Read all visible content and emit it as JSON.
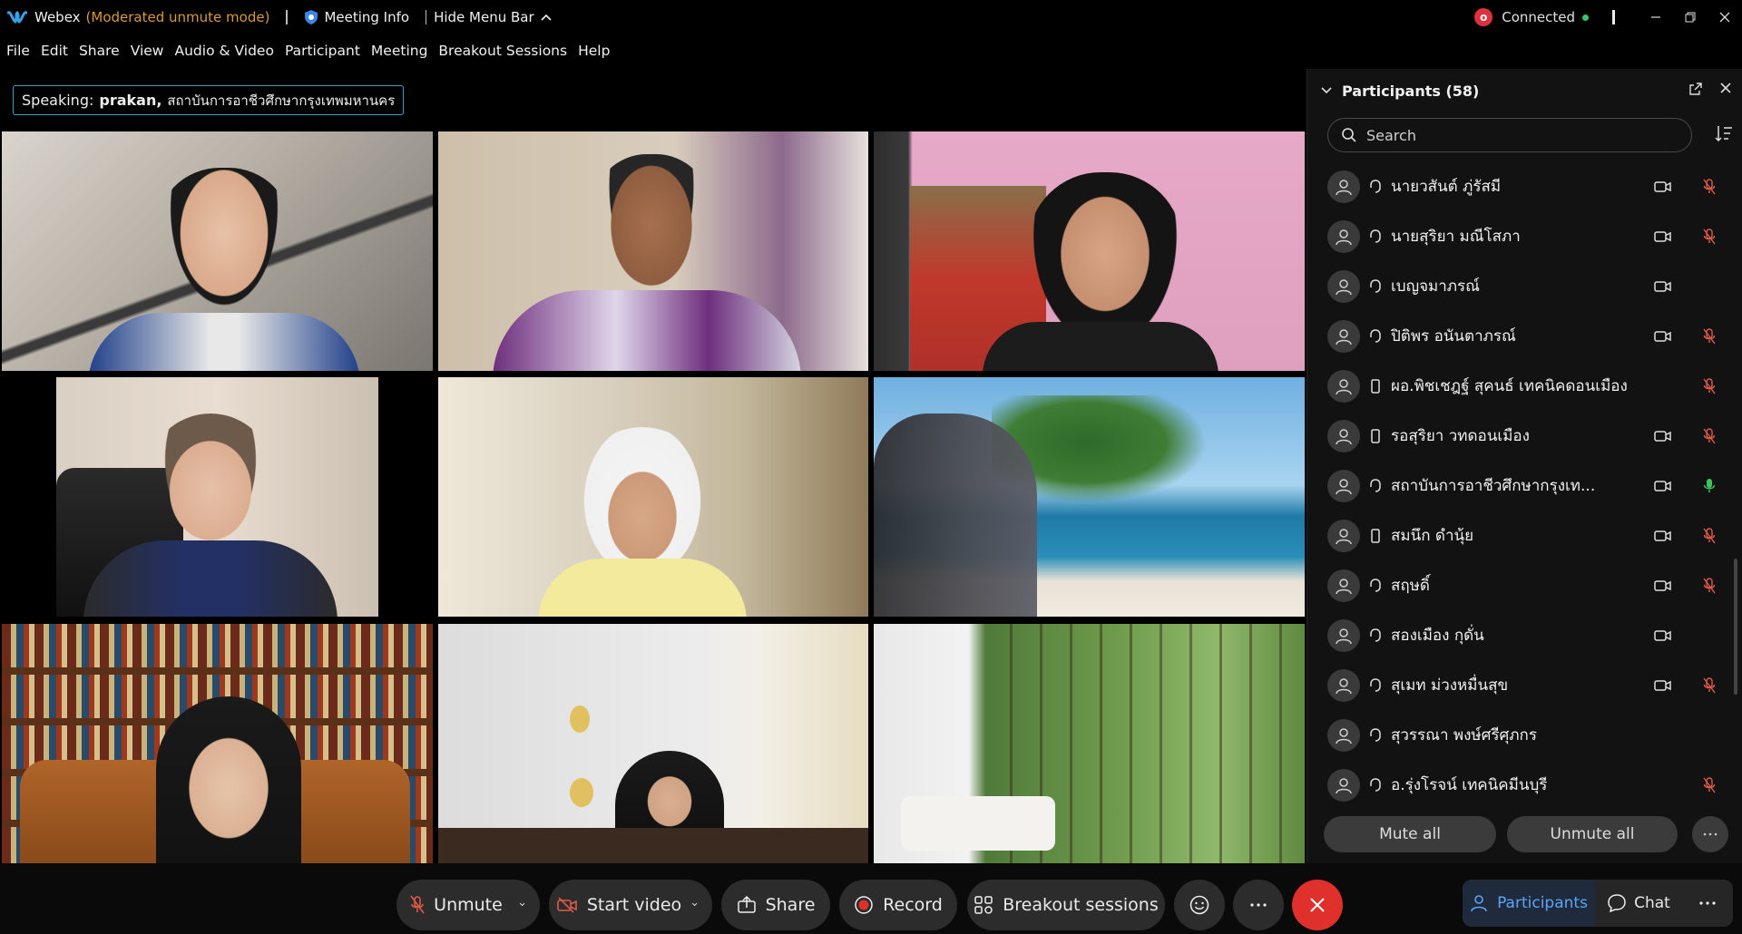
{
  "titlebar": {
    "app_name": "Webex",
    "mode": "(Moderated unmute mode)",
    "meeting_info": "Meeting Info",
    "hide_menu": "Hide Menu Bar",
    "rec_badge": "o",
    "connected": "Connected"
  },
  "menu": [
    "File",
    "Edit",
    "Share",
    "View",
    "Audio & Video",
    "Participant",
    "Meeting",
    "Breakout Sessions",
    "Help"
  ],
  "speaking": {
    "label": "Speaking:",
    "name": "prakan,",
    "org": "สถาบันการอาชีวศึกษากรุงเทพมหานคร"
  },
  "panel": {
    "title": "Participants (58)",
    "search_placeholder": "Search",
    "participants": [
      {
        "name": "นายวสันต์ ภู่รัสมี",
        "device": "headset",
        "camera": true,
        "mic": "muted"
      },
      {
        "name": "นายสุริยา มณีโสภา",
        "device": "headset",
        "camera": true,
        "mic": "muted"
      },
      {
        "name": "เบญจมาภรณ์",
        "device": "headset",
        "camera": true,
        "mic": "none"
      },
      {
        "name": "ปิติพร อนันตาภรณ์",
        "device": "headset",
        "camera": true,
        "mic": "muted"
      },
      {
        "name": "ผอ.พิชเชฎฐ์ สุคนธ์ เทคนิคดอนเมือง",
        "device": "phone",
        "camera": false,
        "mic": "muted"
      },
      {
        "name": "รอสุริยา วทดอนเมือง",
        "device": "phone",
        "camera": true,
        "mic": "muted"
      },
      {
        "name": "สถาบันการอาชีวศึกษากรุงเท...",
        "device": "headset",
        "camera": true,
        "mic": "active"
      },
      {
        "name": "สมนึก ดำนุ้ย",
        "device": "phone",
        "camera": true,
        "mic": "muted"
      },
      {
        "name": "สฤษดิ์",
        "device": "headset",
        "camera": true,
        "mic": "muted"
      },
      {
        "name": "สองเมือง กุดั่น",
        "device": "headset",
        "camera": true,
        "mic": "none"
      },
      {
        "name": "สุเมท ม่วงหมื่นสุข",
        "device": "headset",
        "camera": true,
        "mic": "muted"
      },
      {
        "name": "สุวรรณา พงษ์ศรีศุภกร",
        "device": "headset",
        "camera": false,
        "mic": "none"
      },
      {
        "name": "อ.รุ่งโรจน์ เทคนิคมีนบุรี",
        "device": "headset",
        "camera": false,
        "mic": "muted"
      }
    ],
    "mute_all": "Mute all",
    "unmute_all": "Unmute all"
  },
  "controls": {
    "unmute": "Unmute",
    "start_video": "Start video",
    "share": "Share",
    "record": "Record",
    "breakout": "Breakout sessions",
    "participants": "Participants",
    "chat": "Chat"
  },
  "colors": {
    "accent_blue": "#5ba4f5",
    "mode_orange": "#d89a3c",
    "end_red": "#e0302b",
    "muted_red": "#e05a4a",
    "active_green": "#3fc55c"
  }
}
